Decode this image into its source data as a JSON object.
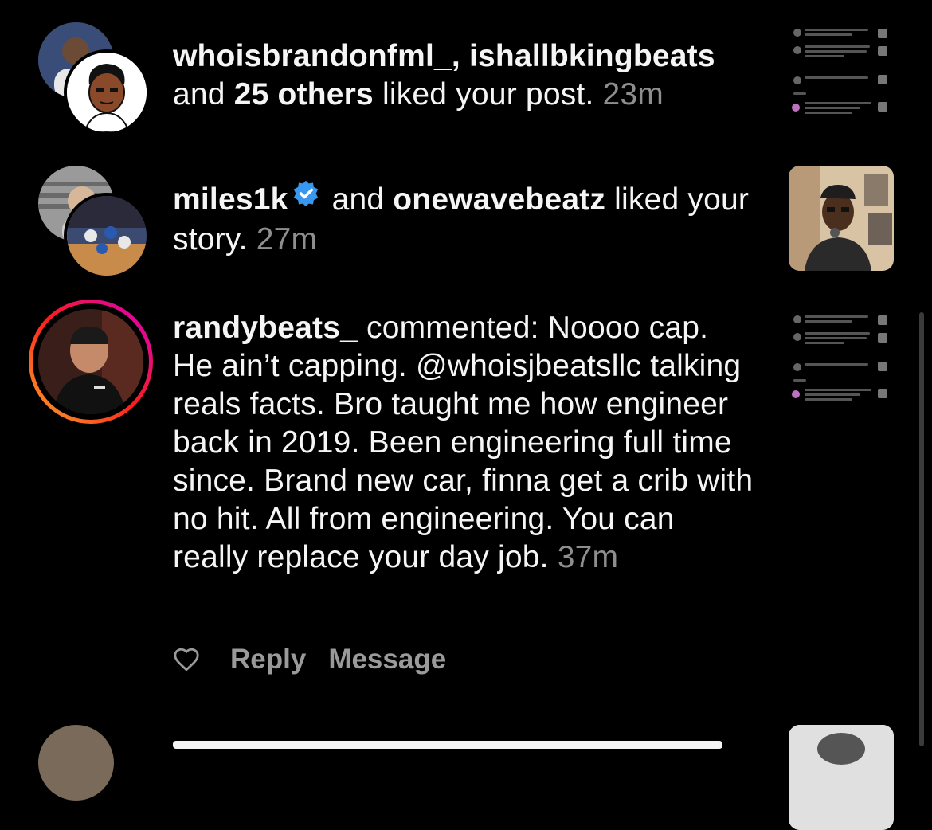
{
  "notifications": [
    {
      "users": "whoisbrandonfml_, ishallbkingbeats",
      "and_text": "and",
      "others": "25 others",
      "action": "liked your post.",
      "time": "23m"
    },
    {
      "user1": "miles1k",
      "and_text": "and",
      "user2": "onewavebeatz",
      "action": "liked your story.",
      "time": "27m"
    },
    {
      "user": "randybeats_",
      "action": "commented:",
      "comment": "Noooo cap. He ain’t capping. @whoisjbeatsllc talking reals facts. Bro taught me how engineer back in 2019. Been engineering full time since. Brand new car, finna get a crib with no hit. All from engineering. You can really replace your day job.",
      "time": "37m",
      "reply_label": "Reply",
      "message_label": "Message"
    }
  ],
  "colors": {
    "text": "#f5f5f5",
    "muted": "#8e8e8e",
    "verified": "#3897f0",
    "story_ring_start": "#f9a825",
    "story_ring_end": "#d300c5"
  },
  "icons": {
    "verified": "verified-badge-icon",
    "heart": "heart-outline-icon"
  }
}
